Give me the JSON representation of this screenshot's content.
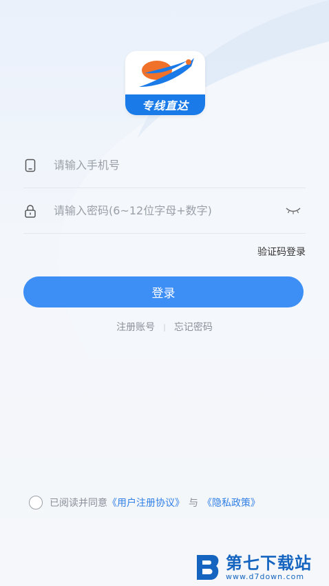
{
  "logo": {
    "text": "专线直达"
  },
  "phone_field": {
    "placeholder": "请输入手机号",
    "value": ""
  },
  "password_field": {
    "placeholder": "请输入密码(6~12位字母+数字)",
    "value": ""
  },
  "sms_login_label": "验证码登录",
  "login_button_label": "登录",
  "links": {
    "register": "注册账号",
    "separator": "|",
    "forgot": "忘记密码"
  },
  "agreement": {
    "prefix": "已阅读并同意",
    "user_agreement": "《用户注册协议》",
    "joiner": "与",
    "privacy_policy": "《隐私政策》"
  },
  "watermark": {
    "title": "第七下载站",
    "url": "www.d7down.com"
  },
  "colors": {
    "primary": "#3d8ef5",
    "link": "#2f7fe6",
    "logo_blue": "#1a7be8",
    "logo_orange": "#f0712a"
  }
}
